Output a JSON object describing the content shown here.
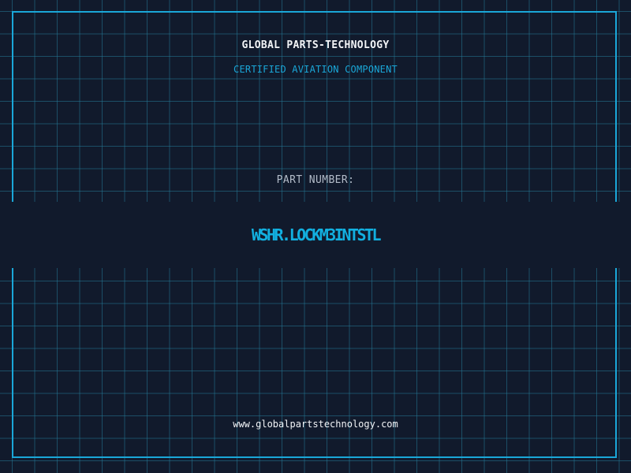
{
  "header": {
    "brand": "GLOBAL PARTS-TECHNOLOGY",
    "subtitle": "CERTIFIED AVIATION COMPONENT"
  },
  "part": {
    "label": "PART NUMBER:",
    "number": "WSHR.LOCKM3INTSTL"
  },
  "footer": {
    "url": "www.globalpartstechnology.com"
  },
  "colors": {
    "background": "#111a2c",
    "accent": "#12b0e0",
    "grid": "#24789 6"
  }
}
